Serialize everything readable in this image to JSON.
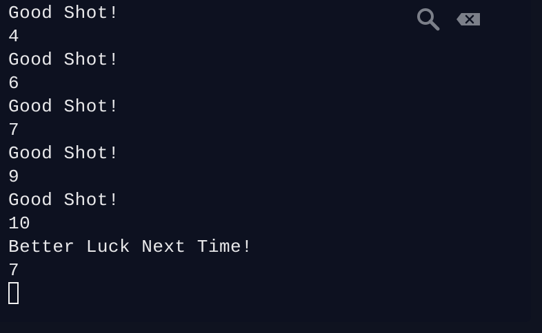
{
  "console": {
    "lines": [
      "Good Shot!",
      "4",
      "Good Shot!",
      "6",
      "Good Shot!",
      "7",
      "Good Shot!",
      "9",
      "Good Shot!",
      "10",
      "Better Luck Next Time!",
      "7"
    ]
  },
  "toolbar": {
    "search_icon": "search-icon",
    "clear_icon": "backspace-clear-icon"
  },
  "colors": {
    "background": "#0d1120",
    "text": "#e8e8ea",
    "icon": "#7b7f89"
  }
}
